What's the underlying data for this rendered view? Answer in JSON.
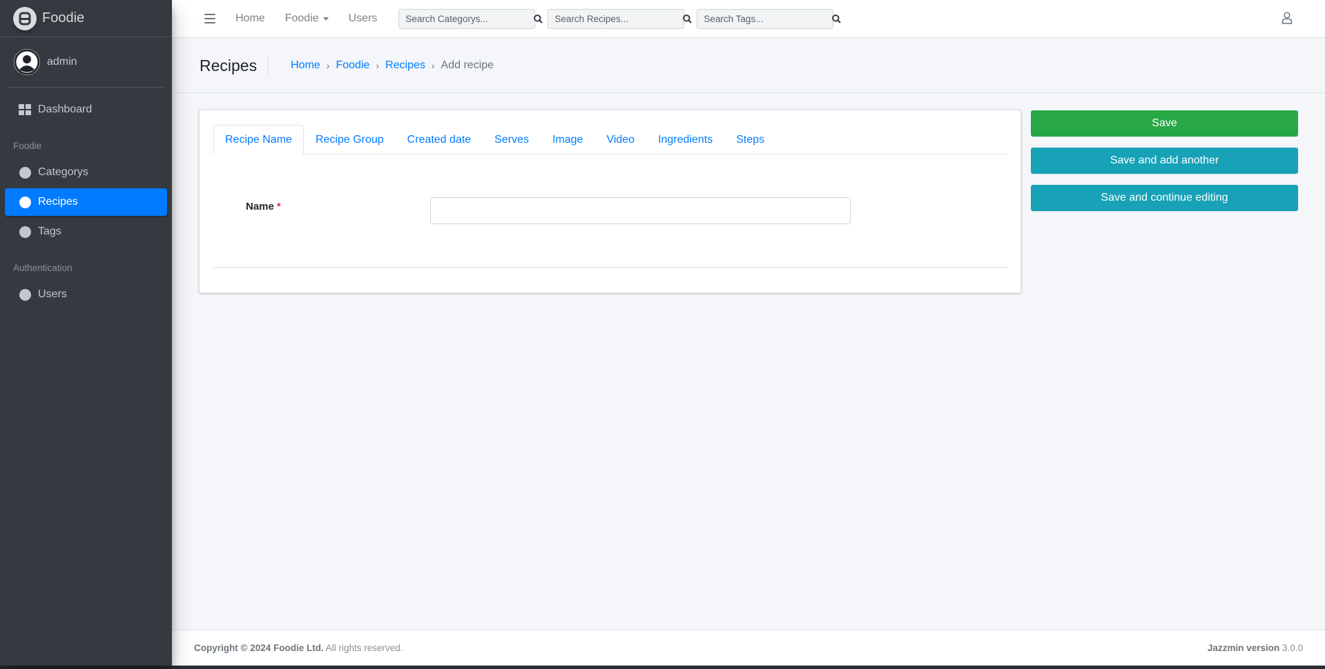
{
  "brand": {
    "name": "Foodie"
  },
  "user": {
    "name": "admin"
  },
  "sidebar": {
    "items": [
      {
        "label": "Dashboard"
      }
    ],
    "sections": [
      {
        "header": "Foodie",
        "items": [
          {
            "label": "Categorys"
          },
          {
            "label": "Recipes"
          },
          {
            "label": "Tags"
          }
        ]
      },
      {
        "header": "Authentication",
        "items": [
          {
            "label": "Users"
          }
        ]
      }
    ],
    "active_item": "Recipes"
  },
  "topbar": {
    "links": [
      {
        "label": "Home"
      },
      {
        "label": "Foodie"
      },
      {
        "label": "Users"
      }
    ],
    "searches": [
      {
        "placeholder": "Search Categorys..."
      },
      {
        "placeholder": "Search Recipes..."
      },
      {
        "placeholder": "Search Tags..."
      }
    ]
  },
  "header": {
    "title": "Recipes",
    "breadcrumb": [
      {
        "label": "Home"
      },
      {
        "label": "Foodie"
      },
      {
        "label": "Recipes"
      }
    ],
    "breadcrumb_separator": "›",
    "breadcrumb_current": "Add recipe"
  },
  "form": {
    "tabs": [
      {
        "label": "Recipe Name"
      },
      {
        "label": "Recipe Group"
      },
      {
        "label": "Created date"
      },
      {
        "label": "Serves"
      },
      {
        "label": "Image"
      },
      {
        "label": "Video"
      },
      {
        "label": "Ingredients"
      },
      {
        "label": "Steps"
      }
    ],
    "active_tab": "Recipe Name",
    "name_field": {
      "label": "Name",
      "required_mark": "*",
      "value": ""
    }
  },
  "actions": {
    "save": "Save",
    "save_add_another": "Save and add another",
    "save_continue": "Save and continue editing"
  },
  "footer": {
    "copyright_bold": "Copyright © 2024 Foodie Ltd.",
    "copyright_rest": " All rights reserved.",
    "version_label": "Jazzmin version",
    "version_value": " 3.0.0"
  },
  "colors": {
    "sidebar_bg": "#343a40",
    "accent": "#007bff",
    "success": "#28a745",
    "info": "#17a2b8",
    "required": "#dc3545"
  },
  "icons": {
    "brand": "brand-logo-icon",
    "user": "user-avatar-icon",
    "dashboard": "grid-icon",
    "nav_item": "circle-icon",
    "menu": "hamburger-icon",
    "search": "search-icon",
    "account": "user-outline-icon"
  }
}
